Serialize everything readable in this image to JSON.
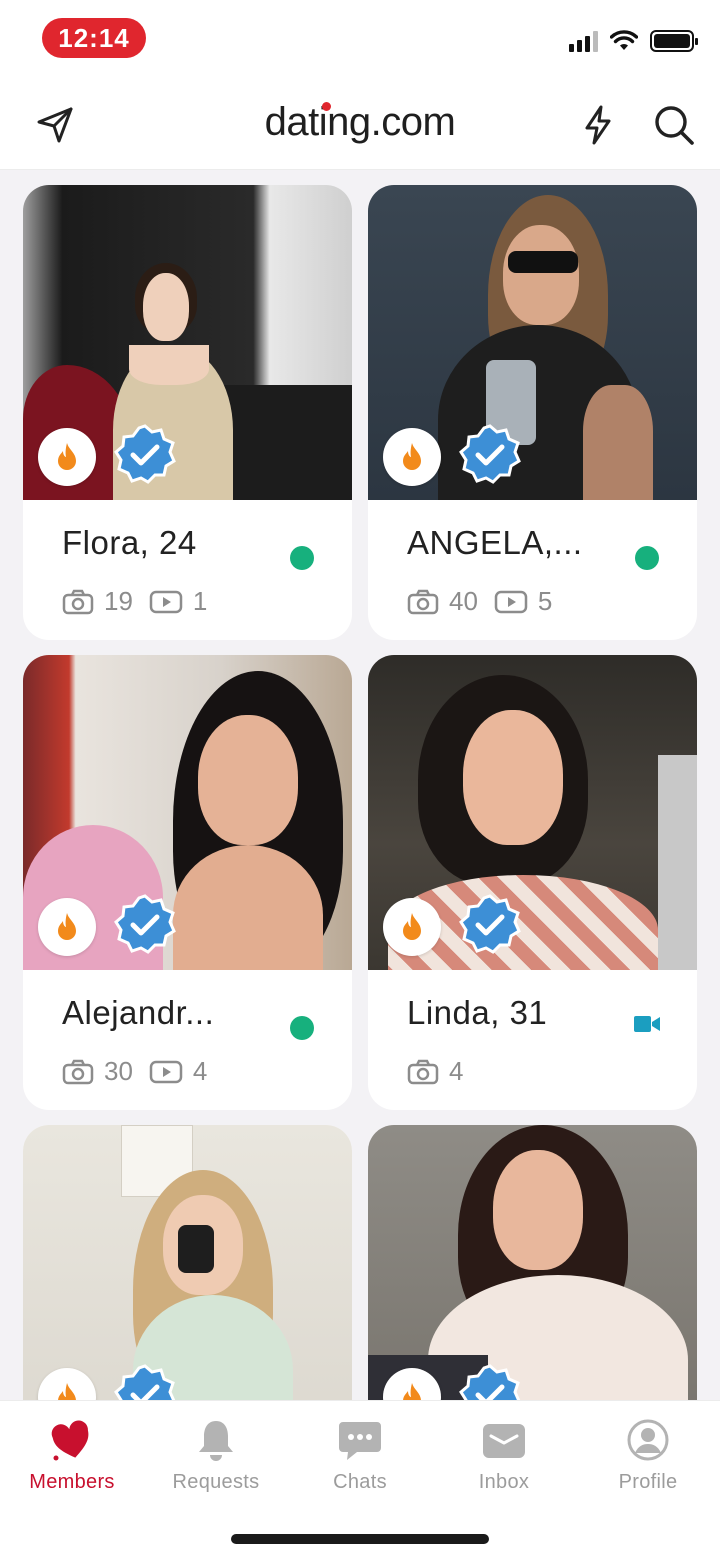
{
  "status_bar": {
    "time": "12:14"
  },
  "header": {
    "logo": "dating.com"
  },
  "colors": {
    "accent": "#c8102e",
    "online": "#17b07d",
    "verified": "#3d8fd6",
    "video": "#1b9ec0"
  },
  "members": [
    {
      "name": "Flora, 24",
      "photos": "19",
      "videos": "1",
      "status": "online"
    },
    {
      "name": "ANGELA,...",
      "photos": "40",
      "videos": "5",
      "status": "online"
    },
    {
      "name": "Alejandr...",
      "photos": "30",
      "videos": "4",
      "status": "online"
    },
    {
      "name": "Linda, 31",
      "photos": "4",
      "status": "video"
    },
    {
      "name": "",
      "photos": "",
      "videos": ""
    },
    {
      "name": "",
      "photos": "",
      "videos": ""
    }
  ],
  "nav": {
    "items": [
      {
        "label": "Members",
        "icon": "heart-icon",
        "active": true
      },
      {
        "label": "Requests",
        "icon": "bell-icon"
      },
      {
        "label": "Chats",
        "icon": "chat-bubble-icon"
      },
      {
        "label": "Inbox",
        "icon": "envelope-icon"
      },
      {
        "label": "Profile",
        "icon": "user-circle-icon"
      }
    ]
  }
}
